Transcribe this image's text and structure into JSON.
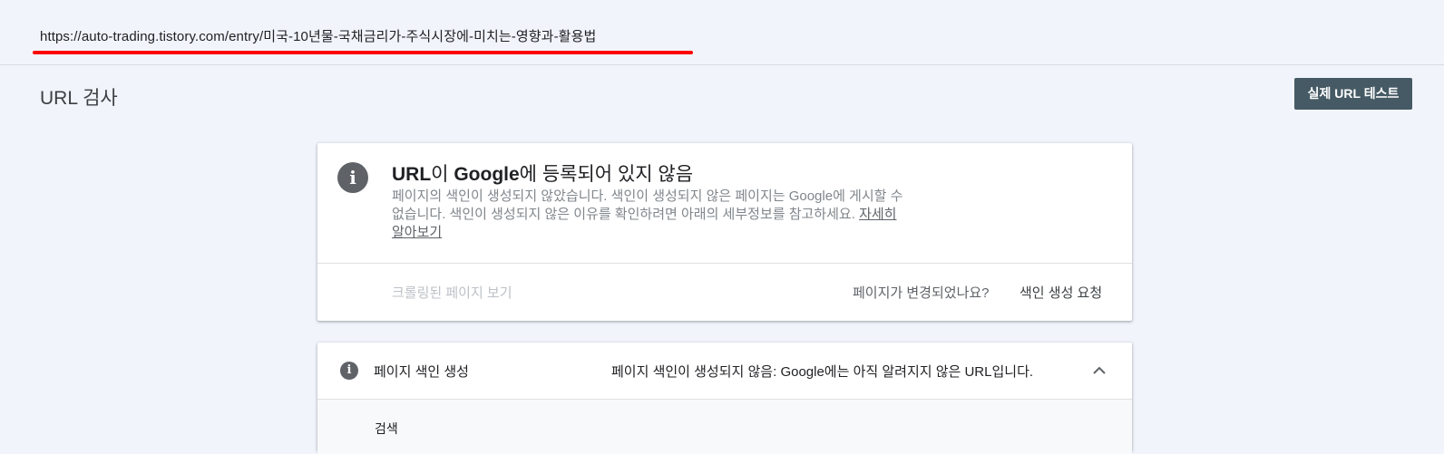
{
  "url_bar": {
    "url": "https://auto-trading.tistory.com/entry/미국-10년물-국채금리가-주식시장에-미치는-영향과-활용법",
    "underline_color": "#ff0000"
  },
  "header": {
    "title": "URL 검사",
    "test_button_label": "실제 URL 테스트"
  },
  "status_card": {
    "icon": "info-icon",
    "heading_part1": "URL",
    "heading_part2": "이 ",
    "heading_part3": "Google",
    "heading_part4": "에 등록되어 있지 않음",
    "description": "페이지의 색인이 생성되지 않았습니다. 색인이 생성되지 않은 페이지는 Google에 게시할 수 없습니다. 색인이 생성되지 않은 이유를 확인하려면 아래의 세부정보를 참고하세요.",
    "learn_more": "자세히 알아보기",
    "crawled_page_link": "크롤링된 페이지 보기",
    "changed_question": "페이지가 변경되었나요?",
    "request_indexing": "색인 생성 요청"
  },
  "indexing_card": {
    "icon": "info-icon",
    "label": "페이지 색인 생성",
    "status": "페이지 색인이 생성되지 않음: Google에는 아직 알려지지 않은 URL입니다.",
    "expanded": true,
    "section_title": "검색"
  },
  "colors": {
    "background": "#f1f4fb",
    "button": "#455a64",
    "icon": "#5f6368"
  }
}
